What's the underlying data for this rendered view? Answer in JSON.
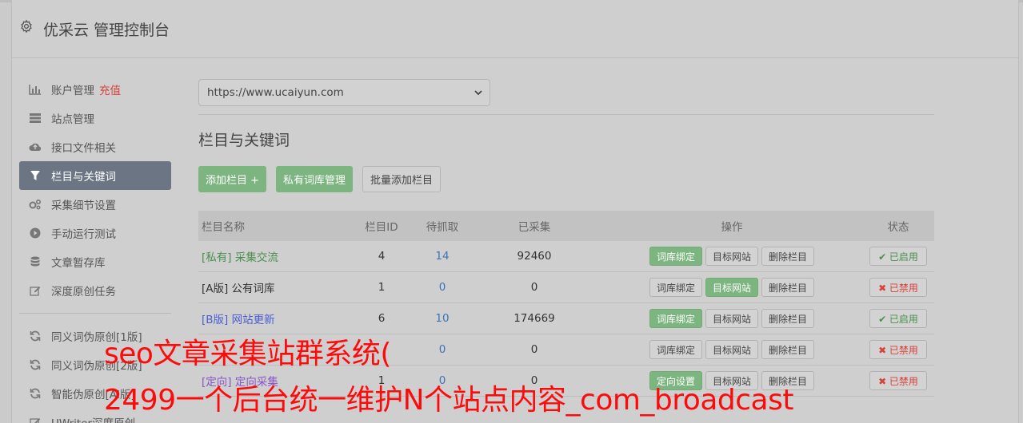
{
  "header": {
    "title": "优采云 管理控制台"
  },
  "sidebar": {
    "items": [
      {
        "label": "账户管理",
        "extra": "充值",
        "icon": "bar-chart-icon"
      },
      {
        "label": "站点管理",
        "icon": "server-icon"
      },
      {
        "label": "接口文件相关",
        "icon": "cloud-upload-icon"
      },
      {
        "label": "栏目与关键词",
        "icon": "filter-icon",
        "active": true
      },
      {
        "label": "采集细节设置",
        "icon": "gears-icon"
      },
      {
        "label": "手动运行测试",
        "icon": "play-circle-icon"
      },
      {
        "label": "文章暂存库",
        "icon": "database-icon"
      },
      {
        "label": "深度原创任务",
        "icon": "edit-icon"
      }
    ],
    "items2": [
      {
        "label": "同义词伪原创[1版]",
        "icon": "refresh-icon"
      },
      {
        "label": "同义词伪原创[2版]",
        "icon": "refresh-icon"
      },
      {
        "label": "智能伪原创[AI版]",
        "icon": "refresh-icon"
      },
      {
        "label": "UWriter深度原创",
        "icon": "edit-icon"
      }
    ]
  },
  "main": {
    "site_select": "https://www.ucaiyun.com",
    "section_title": "栏目与关键词",
    "buttons": {
      "add": "添加栏目 +",
      "private": "私有词库管理",
      "batch": "批量添加栏目"
    },
    "table": {
      "headers": [
        "栏目名称",
        "栏目ID",
        "待抓取",
        "已采集",
        "操作",
        "状态"
      ],
      "rows": [
        {
          "name": "[私有] 采集交流",
          "id": "4",
          "pending": "14",
          "collected": "92460",
          "a1": "词库绑定",
          "a2": "目标网站",
          "a3": "删除栏目",
          "status": "✔ 已启用"
        },
        {
          "name": "[A版] 公有词库",
          "id": "1",
          "pending": "0",
          "collected": "0",
          "a1": "词库绑定",
          "a2": "目标网站",
          "a3": "删除栏目",
          "status": "✖ 已禁用"
        },
        {
          "name": "[B版] 网站更新",
          "id": "6",
          "pending": "10",
          "collected": "174669",
          "a1": "词库绑定",
          "a2": "目标网站",
          "a3": "删除栏目",
          "status": "✔ 已启用"
        },
        {
          "name": "",
          "id": "",
          "pending": "0",
          "collected": "0",
          "a1": "词库绑定",
          "a2": "目标网站",
          "a3": "删除栏目",
          "status": "✖ 已禁用"
        },
        {
          "name": "[定向] 定向采集",
          "id": "1",
          "pending": "0",
          "collected": "0",
          "a1": "定向设置",
          "a2": "目标网站",
          "a3": "删除栏目",
          "status": "✖ 已禁用"
        }
      ]
    }
  },
  "overlay": {
    "line1": "seo文章采集站群系统(",
    "line2": "2499一个后台统一维护N个站点内容_com_broadcast"
  }
}
